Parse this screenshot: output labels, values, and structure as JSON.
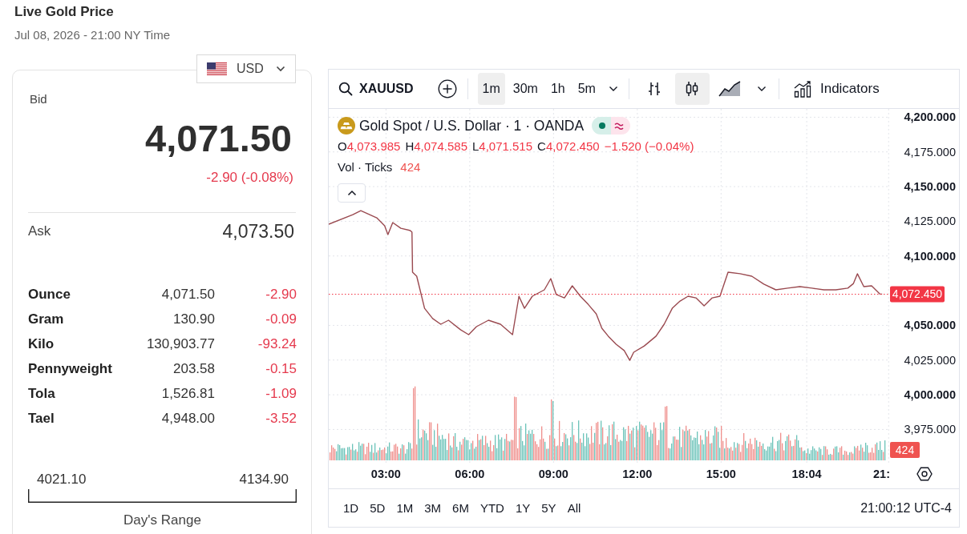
{
  "header": {
    "title": "Live Gold Price",
    "timestamp": "Jul 08, 2026 - 21:00 NY Time"
  },
  "currency": {
    "code": "USD"
  },
  "price_card": {
    "bid_label": "Bid",
    "bid": "4,071.50",
    "change": "-2.90 (-0.08%)",
    "ask_label": "Ask",
    "ask": "4,073.50",
    "units": [
      {
        "name": "Ounce",
        "price": "4,071.50",
        "change": "-2.90"
      },
      {
        "name": "Gram",
        "price": "130.90",
        "change": "-0.09"
      },
      {
        "name": "Kilo",
        "price": "130,903.77",
        "change": "-93.24"
      },
      {
        "name": "Pennyweight",
        "price": "203.58",
        "change": "-0.15"
      },
      {
        "name": "Tola",
        "price": "1,526.81",
        "change": "-1.09"
      },
      {
        "name": "Tael",
        "price": "4,948.00",
        "change": "-3.52"
      }
    ],
    "day_range": {
      "low": "4021.10",
      "high": "4134.90",
      "label": "Day's Range"
    }
  },
  "chart_widget": {
    "symbol": "XAUUSD",
    "intervals": [
      {
        "label": "1m",
        "selected": true
      },
      {
        "label": "30m",
        "selected": false
      },
      {
        "label": "1h",
        "selected": false
      },
      {
        "label": "5m",
        "selected": false
      }
    ],
    "chart_types": [
      {
        "kind": "bars",
        "selected": false
      },
      {
        "kind": "candles",
        "selected": true
      },
      {
        "kind": "area",
        "selected": false
      }
    ],
    "indicators_label": "Indicators",
    "legend": {
      "title": "Gold Spot / U.S. Dollar · 1 · OANDA",
      "ohlc": [
        {
          "key": "O",
          "value": "4,073.985"
        },
        {
          "key": "H",
          "value": "4,074.585"
        },
        {
          "key": "L",
          "value": "4,071.515"
        },
        {
          "key": "C",
          "value": "4,072.450"
        }
      ],
      "change": "−1.520 (−0.04%)",
      "volume_label": "Vol · Ticks",
      "volume_value": "424"
    },
    "chart_data": {
      "type": "line",
      "x": [
        0.95,
        1.81,
        2.1,
        2.67,
        2.95,
        3.07,
        3.24,
        3.53,
        3.87,
        3.93,
        3.95,
        4.1,
        4.24,
        4.38,
        4.67,
        4.96,
        5.24,
        5.67,
        5.96,
        6.24,
        6.67,
        7.1,
        7.53,
        7.76,
        7.96,
        8.24,
        8.67,
        8.9,
        9.1,
        9.39,
        9.67,
        9.96,
        10.24,
        10.53,
        10.73,
        10.96,
        11.24,
        11.53,
        11.73,
        11.87,
        12.25,
        12.67,
        12.96,
        13.25,
        13.53,
        13.82,
        14.1,
        14.39,
        14.68,
        14.96,
        15.25,
        15.68,
        16.1,
        16.53,
        16.96,
        17.39,
        17.82,
        18.25,
        18.68,
        19.11,
        19.54,
        19.74,
        19.88,
        20.11,
        20.39,
        20.68,
        20.77
      ],
      "series": [
        {
          "color": "#9a4a50",
          "values": [
            4122.9,
            4129.8,
            4132.7,
            4127.5,
            4121.8,
            4115.4,
            4124.1,
            4120.0,
            4118.3,
            4117.2,
            4088.3,
            4085.4,
            4073.9,
            4062.3,
            4054.9,
            4050.8,
            4053.7,
            4046.8,
            4043.3,
            4049.1,
            4053.7,
            4050.8,
            4043.3,
            4071.0,
            4062.3,
            4071.0,
            4075.6,
            4083.7,
            4072.2,
            4069.8,
            4078.5,
            4071.0,
            4065.2,
            4058.3,
            4047.9,
            4042.2,
            4036.4,
            4031.8,
            4024.8,
            4030.6,
            4035.2,
            4042.2,
            4050.8,
            4062.3,
            4067.5,
            4071.0,
            4069.8,
            4064.1,
            4069.8,
            4071.0,
            4088.3,
            4087.2,
            4085.4,
            4079.7,
            4075.6,
            4076.8,
            4077.9,
            4076.8,
            4075.6,
            4075.6,
            4076.8,
            4080.2,
            4087.2,
            4077.9,
            4078.5,
            4072.7,
            4072.5
          ]
        }
      ],
      "xlim": [
        0.95,
        21.05
      ],
      "ylim": [
        3951,
        4206
      ],
      "xticks": [
        {
          "value": 3,
          "label": "03:00"
        },
        {
          "value": 6,
          "label": "06:00"
        },
        {
          "value": 9,
          "label": "09:00"
        },
        {
          "value": 12,
          "label": "12:00"
        },
        {
          "value": 15,
          "label": "15:00"
        },
        {
          "value": 18.067,
          "label": "18:04"
        },
        {
          "value": 21,
          "label": "21:"
        }
      ],
      "yticks": [
        {
          "value": 4200,
          "label": "4,200.000"
        },
        {
          "value": 4175,
          "label": "4,175.000"
        },
        {
          "value": 4150,
          "label": "4,150.000"
        },
        {
          "value": 4125,
          "label": "4,125.000"
        },
        {
          "value": 4100,
          "label": "4,100.000"
        },
        {
          "value": 4050,
          "label": "4,050.000"
        },
        {
          "value": 4025,
          "label": "4,025.000"
        },
        {
          "value": 4000,
          "label": "4,000.000"
        },
        {
          "value": 3975,
          "label": "3,975.000"
        }
      ],
      "grid": true,
      "ref_lines": [
        {
          "axis": "y",
          "value": 4072.45,
          "label": "4,072.450"
        }
      ]
    },
    "volume_axis_label": "424",
    "ranges": [
      "1D",
      "5D",
      "1M",
      "3M",
      "6M",
      "YTD",
      "1Y",
      "5Y",
      "All"
    ],
    "clock": "21:00:12 UTC-4"
  }
}
